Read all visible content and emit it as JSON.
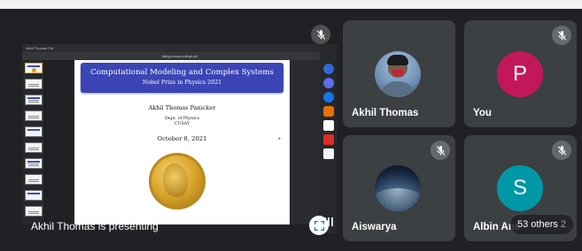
{
  "presenter": {
    "label": "Akhil Thomas is presenting",
    "pdf_tab": "Akhil Thomas Pdf",
    "pdf_filename": "listing-thomas-college.pdf",
    "slide": {
      "title": "Computational Modeling and Complex Systems",
      "subtitle": "Nobel Prize in Physics 2021",
      "author": "Akhil Thomas Panicker",
      "dept_line1": "Dept. of Physics",
      "dept_line2": "CUSAT",
      "date": "October 8, 2021"
    }
  },
  "participants": [
    {
      "name": "Akhil Thomas",
      "avatar": "photo",
      "muted": false
    },
    {
      "name": "You",
      "avatar_letter": "P",
      "avatar_color": "#c2185b",
      "muted": true
    },
    {
      "name": "Aiswarya",
      "avatar": "photo",
      "muted": true
    },
    {
      "name": "Albin Ane",
      "name_tail": "2",
      "avatar_letter": "S",
      "avatar_color": "#0097a7",
      "muted": true
    }
  ],
  "others_count_label": "53 others",
  "colors": {
    "background": "#202124",
    "tile": "#3c4043",
    "slide_title_bg": "#3b45b5"
  }
}
